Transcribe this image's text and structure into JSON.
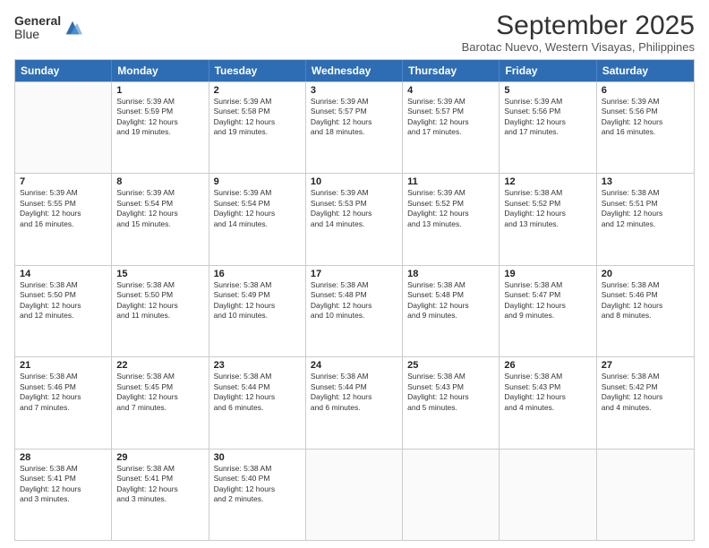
{
  "header": {
    "logo_line1": "General",
    "logo_line2": "Blue",
    "month_title": "September 2025",
    "subtitle": "Barotac Nuevo, Western Visayas, Philippines"
  },
  "days_of_week": [
    "Sunday",
    "Monday",
    "Tuesday",
    "Wednesday",
    "Thursday",
    "Friday",
    "Saturday"
  ],
  "weeks": [
    [
      {
        "day": "",
        "empty": true
      },
      {
        "day": "1",
        "sunrise": "5:39 AM",
        "sunset": "5:59 PM",
        "daylight": "12 hours and 19 minutes."
      },
      {
        "day": "2",
        "sunrise": "5:39 AM",
        "sunset": "5:58 PM",
        "daylight": "12 hours and 19 minutes."
      },
      {
        "day": "3",
        "sunrise": "5:39 AM",
        "sunset": "5:57 PM",
        "daylight": "12 hours and 18 minutes."
      },
      {
        "day": "4",
        "sunrise": "5:39 AM",
        "sunset": "5:57 PM",
        "daylight": "12 hours and 17 minutes."
      },
      {
        "day": "5",
        "sunrise": "5:39 AM",
        "sunset": "5:56 PM",
        "daylight": "12 hours and 17 minutes."
      },
      {
        "day": "6",
        "sunrise": "5:39 AM",
        "sunset": "5:56 PM",
        "daylight": "12 hours and 16 minutes."
      }
    ],
    [
      {
        "day": "7",
        "sunrise": "5:39 AM",
        "sunset": "5:55 PM",
        "daylight": "12 hours and 16 minutes."
      },
      {
        "day": "8",
        "sunrise": "5:39 AM",
        "sunset": "5:54 PM",
        "daylight": "12 hours and 15 minutes."
      },
      {
        "day": "9",
        "sunrise": "5:39 AM",
        "sunset": "5:54 PM",
        "daylight": "12 hours and 14 minutes."
      },
      {
        "day": "10",
        "sunrise": "5:39 AM",
        "sunset": "5:53 PM",
        "daylight": "12 hours and 14 minutes."
      },
      {
        "day": "11",
        "sunrise": "5:39 AM",
        "sunset": "5:52 PM",
        "daylight": "12 hours and 13 minutes."
      },
      {
        "day": "12",
        "sunrise": "5:38 AM",
        "sunset": "5:52 PM",
        "daylight": "12 hours and 13 minutes."
      },
      {
        "day": "13",
        "sunrise": "5:38 AM",
        "sunset": "5:51 PM",
        "daylight": "12 hours and 12 minutes."
      }
    ],
    [
      {
        "day": "14",
        "sunrise": "5:38 AM",
        "sunset": "5:50 PM",
        "daylight": "12 hours and 12 minutes."
      },
      {
        "day": "15",
        "sunrise": "5:38 AM",
        "sunset": "5:50 PM",
        "daylight": "12 hours and 11 minutes."
      },
      {
        "day": "16",
        "sunrise": "5:38 AM",
        "sunset": "5:49 PM",
        "daylight": "12 hours and 10 minutes."
      },
      {
        "day": "17",
        "sunrise": "5:38 AM",
        "sunset": "5:48 PM",
        "daylight": "12 hours and 10 minutes."
      },
      {
        "day": "18",
        "sunrise": "5:38 AM",
        "sunset": "5:48 PM",
        "daylight": "12 hours and 9 minutes."
      },
      {
        "day": "19",
        "sunrise": "5:38 AM",
        "sunset": "5:47 PM",
        "daylight": "12 hours and 9 minutes."
      },
      {
        "day": "20",
        "sunrise": "5:38 AM",
        "sunset": "5:46 PM",
        "daylight": "12 hours and 8 minutes."
      }
    ],
    [
      {
        "day": "21",
        "sunrise": "5:38 AM",
        "sunset": "5:46 PM",
        "daylight": "12 hours and 7 minutes."
      },
      {
        "day": "22",
        "sunrise": "5:38 AM",
        "sunset": "5:45 PM",
        "daylight": "12 hours and 7 minutes."
      },
      {
        "day": "23",
        "sunrise": "5:38 AM",
        "sunset": "5:44 PM",
        "daylight": "12 hours and 6 minutes."
      },
      {
        "day": "24",
        "sunrise": "5:38 AM",
        "sunset": "5:44 PM",
        "daylight": "12 hours and 6 minutes."
      },
      {
        "day": "25",
        "sunrise": "5:38 AM",
        "sunset": "5:43 PM",
        "daylight": "12 hours and 5 minutes."
      },
      {
        "day": "26",
        "sunrise": "5:38 AM",
        "sunset": "5:43 PM",
        "daylight": "12 hours and 4 minutes."
      },
      {
        "day": "27",
        "sunrise": "5:38 AM",
        "sunset": "5:42 PM",
        "daylight": "12 hours and 4 minutes."
      }
    ],
    [
      {
        "day": "28",
        "sunrise": "5:38 AM",
        "sunset": "5:41 PM",
        "daylight": "12 hours and 3 minutes."
      },
      {
        "day": "29",
        "sunrise": "5:38 AM",
        "sunset": "5:41 PM",
        "daylight": "12 hours and 3 minutes."
      },
      {
        "day": "30",
        "sunrise": "5:38 AM",
        "sunset": "5:40 PM",
        "daylight": "12 hours and 2 minutes."
      },
      {
        "day": "",
        "empty": true
      },
      {
        "day": "",
        "empty": true
      },
      {
        "day": "",
        "empty": true
      },
      {
        "day": "",
        "empty": true
      }
    ]
  ],
  "labels": {
    "sunrise": "Sunrise:",
    "sunset": "Sunset:",
    "daylight": "Daylight:"
  }
}
